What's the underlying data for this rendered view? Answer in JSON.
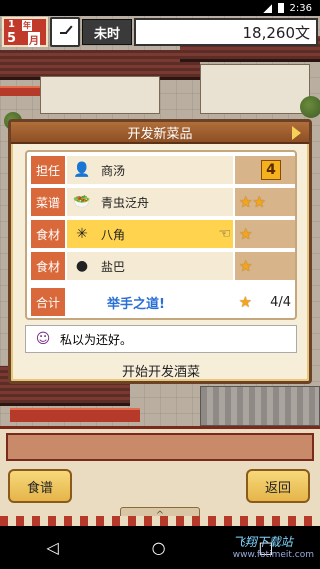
{
  "status_bar": {
    "time": "2:36"
  },
  "hud": {
    "year": "1",
    "year_label": "年",
    "month": "5",
    "month_label": "月",
    "time_of_day": "未时",
    "money": "18,260文"
  },
  "dialog": {
    "title": "开发新菜品",
    "rows": [
      {
        "label": "担任",
        "value": "商汤",
        "icon": "chef-portrait-icon",
        "badge": "4"
      },
      {
        "label": "菜谱",
        "value": "青虫泛舟",
        "icon": "dish-icon",
        "stars": 2
      },
      {
        "label": "食材",
        "value": "八角",
        "icon": "star-anise-icon",
        "stars": 1,
        "selected": true
      },
      {
        "label": "食材",
        "value": "盐巴",
        "icon": "salt-icon",
        "stars": 1
      }
    ],
    "total": {
      "label": "合计",
      "title": "举手之道!",
      "count": "4/4"
    },
    "comment": "私以为还好。",
    "action": "开始开发酒菜"
  },
  "bottom": {
    "left_button": "食谱",
    "right_button": "返回",
    "handle": "^"
  },
  "watermark": {
    "main": "飞翔下载站",
    "sub": "www.fotimeit.com"
  }
}
